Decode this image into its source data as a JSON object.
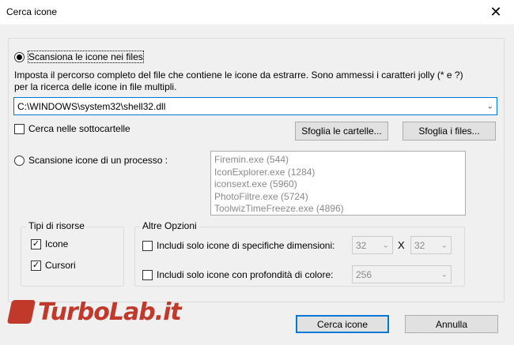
{
  "window": {
    "title": "Cerca icone"
  },
  "scan_files": {
    "label": "Scansiona le icone nei files",
    "description_line1": "Imposta il percorso completo del file che contiene le icone da estrarre. Sono ammessi i caratteri jolly (* e ?)",
    "description_line2": "per la ricerca delle icone in file multipli.",
    "path_value": "C:\\WINDOWS\\system32\\shell32.dll",
    "subfolders_label": "Cerca nelle sottocartelle",
    "browse_folders_label": "Sfoglia le cartelle...",
    "browse_files_label": "Sfoglia i files..."
  },
  "scan_process": {
    "label": "Scansione icone di un processo :",
    "processes": [
      "Firemin.exe  (544)",
      "IconExplorer.exe  (1284)",
      "iconsext.exe  (5960)",
      "PhotoFiltre.exe  (5724)",
      "ToolwizTimeFreeze.exe  (4896)"
    ]
  },
  "resource_types": {
    "legend": "Tipi di risorse",
    "icons_label": "Icone",
    "cursors_label": "Cursori"
  },
  "other_options": {
    "legend": "Altre Opzioni",
    "size_label": "Includi solo icone di specifiche dimensioni:",
    "width_value": "32",
    "times": "X",
    "height_value": "32",
    "depth_label": "Includi solo icone con profondità di colore:",
    "depth_value": "256"
  },
  "buttons": {
    "search_label": "Cerca icone",
    "cancel_label": "Annulla"
  },
  "watermark": {
    "text": "TurboLab.it"
  },
  "colors": {
    "accent": "#0078d7",
    "dialog_bg": "#f0f0f0",
    "watermark": "#c0392b"
  }
}
